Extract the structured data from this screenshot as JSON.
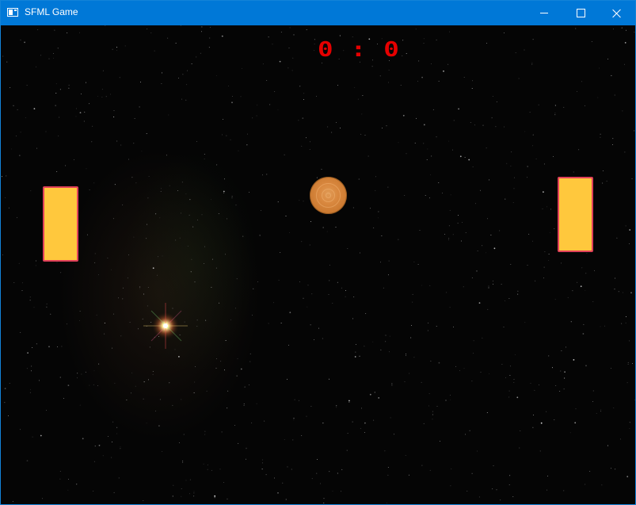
{
  "window": {
    "title": "SFML Game",
    "icon": "app-window-icon",
    "titlebar_color": "#0078d7",
    "controls": [
      "minimize-icon",
      "maximize-icon",
      "close-icon"
    ]
  },
  "game": {
    "score": "0 : 0",
    "score_color": "#e50000",
    "paddle_fill": "#ffc83d",
    "paddle_border": "#e0405a",
    "ball_color": "#d9883f",
    "background": "starfield"
  }
}
